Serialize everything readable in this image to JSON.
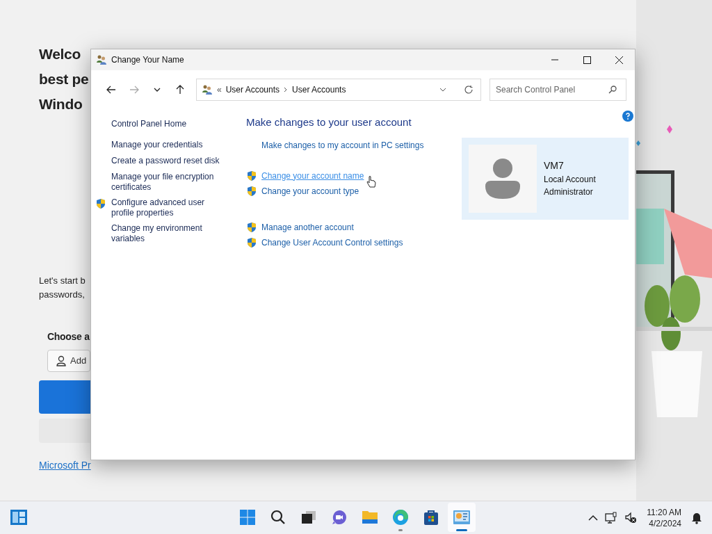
{
  "background_page": {
    "heading_lines": [
      "Welco",
      "best pe",
      "Windo"
    ],
    "intro_lines": [
      "Let's start b",
      "passwords,"
    ],
    "choose_label": "Choose a",
    "add_button": "Add",
    "link": "Microsoft Pr"
  },
  "window": {
    "title": "Change Your Name",
    "address": {
      "overflow": "«",
      "path": [
        "User Accounts",
        "User Accounts"
      ]
    },
    "search": {
      "placeholder": "Search Control Panel"
    },
    "left_pane": [
      {
        "label": "Control Panel Home",
        "shield": false
      },
      {
        "label": "Manage your credentials",
        "shield": false
      },
      {
        "label": "Create a password reset disk",
        "shield": false
      },
      {
        "label": "Manage your file encryption certificates",
        "shield": false
      },
      {
        "label": "Configure advanced user profile properties",
        "shield": true
      },
      {
        "label": "Change my environment variables",
        "shield": false
      }
    ],
    "heading": "Make changes to your user account",
    "task_groups": [
      [
        {
          "label": "Make changes to my account in PC settings",
          "shield": false,
          "hovered": false
        }
      ],
      [
        {
          "label": "Change your account name",
          "shield": true,
          "hovered": true
        },
        {
          "label": "Change your account type",
          "shield": true,
          "hovered": false
        }
      ],
      [
        {
          "label": "Manage another account",
          "shield": true,
          "hovered": false
        },
        {
          "label": "Change User Account Control settings",
          "shield": true,
          "hovered": false
        }
      ]
    ],
    "account": {
      "name": "VM7",
      "type": "Local Account",
      "role": "Administrator"
    }
  },
  "taskbar": {
    "apps": [
      {
        "kind": "start",
        "selected": false,
        "running": false
      },
      {
        "kind": "search",
        "selected": false,
        "running": false
      },
      {
        "kind": "taskview",
        "selected": false,
        "running": false
      },
      {
        "kind": "chat",
        "selected": false,
        "running": false
      },
      {
        "kind": "explorer",
        "selected": false,
        "running": false
      },
      {
        "kind": "edge",
        "selected": false,
        "running": true
      },
      {
        "kind": "store",
        "selected": false,
        "running": false
      },
      {
        "kind": "controlpanel",
        "selected": true,
        "running": true
      }
    ],
    "time": "11:20 AM",
    "date": "4/2/2024"
  }
}
